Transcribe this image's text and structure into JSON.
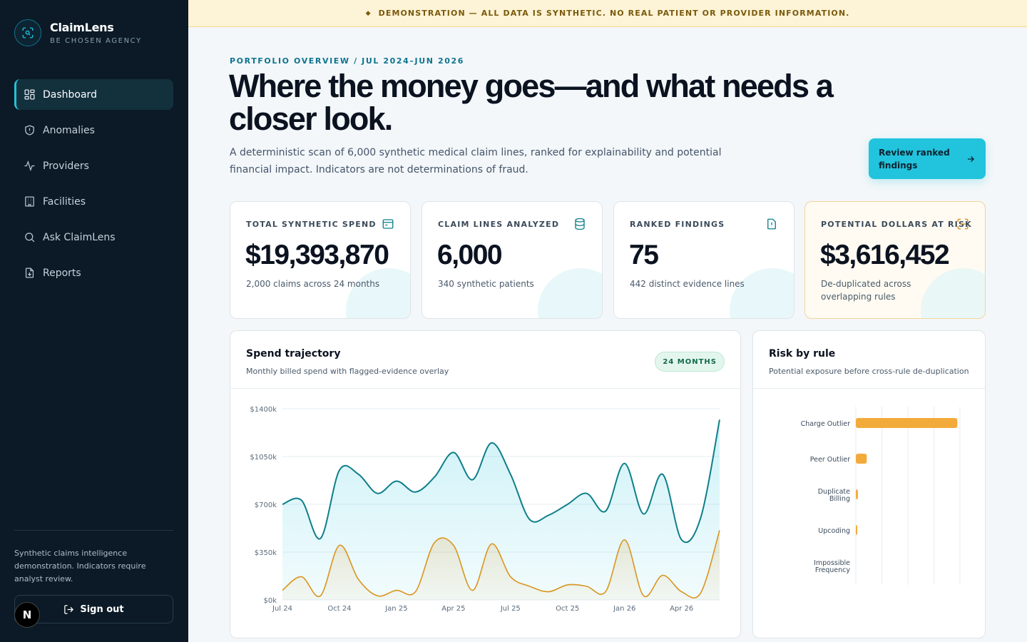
{
  "brand": {
    "name": "ClaimLens",
    "tagline": "BE CHOSEN AGENCY"
  },
  "nav": [
    {
      "label": "Dashboard",
      "icon": "dashboard-grid-icon",
      "active": true
    },
    {
      "label": "Anomalies",
      "icon": "shield-icon",
      "active": false
    },
    {
      "label": "Providers",
      "icon": "activity-pulse-icon",
      "active": false
    },
    {
      "label": "Facilities",
      "icon": "building-icon",
      "active": false
    },
    {
      "label": "Ask ClaimLens",
      "icon": "search-icon",
      "active": false
    },
    {
      "label": "Reports",
      "icon": "file-download-icon",
      "active": false
    }
  ],
  "sidebar_note": "Synthetic claims intelligence demonstration. Indicators require analyst review.",
  "sign_out_label": "Sign out",
  "n_badge": "N",
  "banner": "DEMONSTRATION — ALL DATA IS SYNTHETIC. NO REAL PATIENT OR PROVIDER INFORMATION.",
  "header": {
    "eyebrow": "PORTFOLIO OVERVIEW / JUL 2024–JUN 2026",
    "title": "Where the money goes—and what needs a closer look.",
    "lede": "A deterministic scan of 6,000 synthetic medical claim lines, ranked for explainability and potential financial impact. Indicators are not determinations of fraud.",
    "cta": "Review ranked findings"
  },
  "stats": [
    {
      "label": "TOTAL SYNTHETIC SPEND",
      "value": "$19,393,870",
      "sub": "2,000 claims across 24 months",
      "icon": "wallet-icon"
    },
    {
      "label": "CLAIM LINES ANALYZED",
      "value": "6,000",
      "sub": "340 synthetic patients",
      "icon": "database-icon"
    },
    {
      "label": "RANKED FINDINGS",
      "value": "75",
      "sub": "442 distinct evidence lines",
      "icon": "file-alert-icon"
    },
    {
      "label": "POTENTIAL DOLLARS AT RISK",
      "value": "$3,616,452",
      "sub": "De-duplicated across overlapping rules",
      "icon": "scan-icon"
    }
  ],
  "colors": {
    "accent": "#22c3dd",
    "teal": "#0e7f8a",
    "amber": "#f2ab3a",
    "sidebar": "#0b1a26"
  },
  "chart_data": [
    {
      "type": "area",
      "title": "Spend trajectory",
      "subtitle": "Monthly billed spend with flagged-evidence overlay",
      "badge": "24 MONTHS",
      "ylim": [
        0,
        1400
      ],
      "yticks": [
        "$0k",
        "$350k",
        "$700k",
        "$1050k",
        "$1400k"
      ],
      "xticks": [
        "Jul 24",
        "Oct 24",
        "Jan 25",
        "Apr 25",
        "Jul 25",
        "Oct 25",
        "Jan 26",
        "Apr 26"
      ],
      "x": [
        "Jul 24",
        "Aug 24",
        "Sep 24",
        "Oct 24",
        "Nov 24",
        "Dec 24",
        "Jan 25",
        "Feb 25",
        "Mar 25",
        "Apr 25",
        "May 25",
        "Jun 25",
        "Jul 25",
        "Aug 25",
        "Sep 25",
        "Oct 25",
        "Nov 25",
        "Dec 25",
        "Jan 26",
        "Feb 26",
        "Mar 26",
        "Apr 26",
        "May 26",
        "Jun 26"
      ],
      "series": [
        {
          "values": [
            700,
            730,
            450,
            950,
            920,
            780,
            870,
            790,
            900,
            1080,
            880,
            1150,
            920,
            590,
            620,
            700,
            780,
            650,
            1000,
            630,
            920,
            440,
            600,
            1320
          ]
        },
        {
          "values": [
            70,
            170,
            30,
            400,
            150,
            30,
            70,
            60,
            420,
            400,
            70,
            410,
            170,
            100,
            60,
            110,
            100,
            60,
            440,
            30,
            180,
            60,
            50,
            510
          ]
        }
      ],
      "grid": true
    },
    {
      "type": "bar",
      "orientation": "horizontal",
      "title": "Risk by rule",
      "subtitle": "Potential exposure before cross-rule de-duplication",
      "categories": [
        "Charge Outlier",
        "Peer Outlier",
        "Duplicate Billing",
        "Upcoding",
        "Impossible Frequency"
      ],
      "values": [
        3900000,
        420000,
        80000,
        30000,
        0
      ],
      "xlim": [
        0,
        4000000
      ],
      "grid": true
    }
  ]
}
